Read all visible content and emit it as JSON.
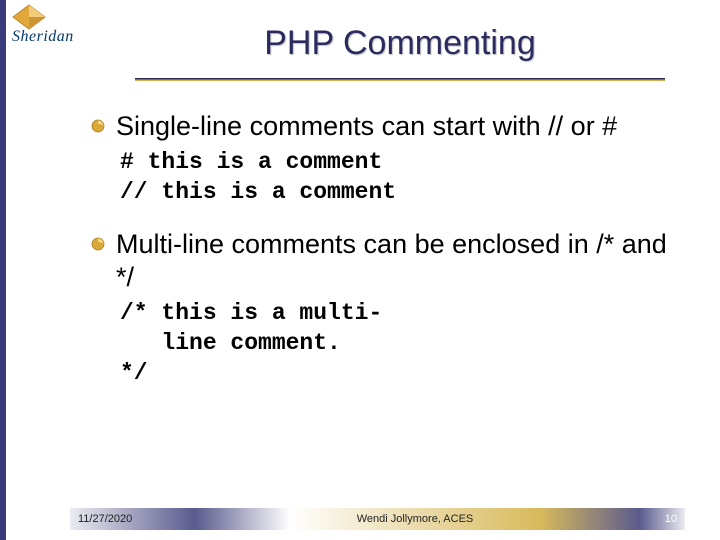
{
  "logo": {
    "text": "Sheridan"
  },
  "title": "PHP Commenting",
  "bullets": [
    {
      "text": "Single-line comments can start with // or #",
      "code": "# this is a comment\n// this is a comment"
    },
    {
      "text": "Multi-line comments can be enclosed in /* and */",
      "code": "/* this is a multi-\n   line comment.\n*/"
    }
  ],
  "footer": {
    "date": "11/27/2020",
    "author": "Wendi Jollymore, ACES",
    "page": "10"
  }
}
